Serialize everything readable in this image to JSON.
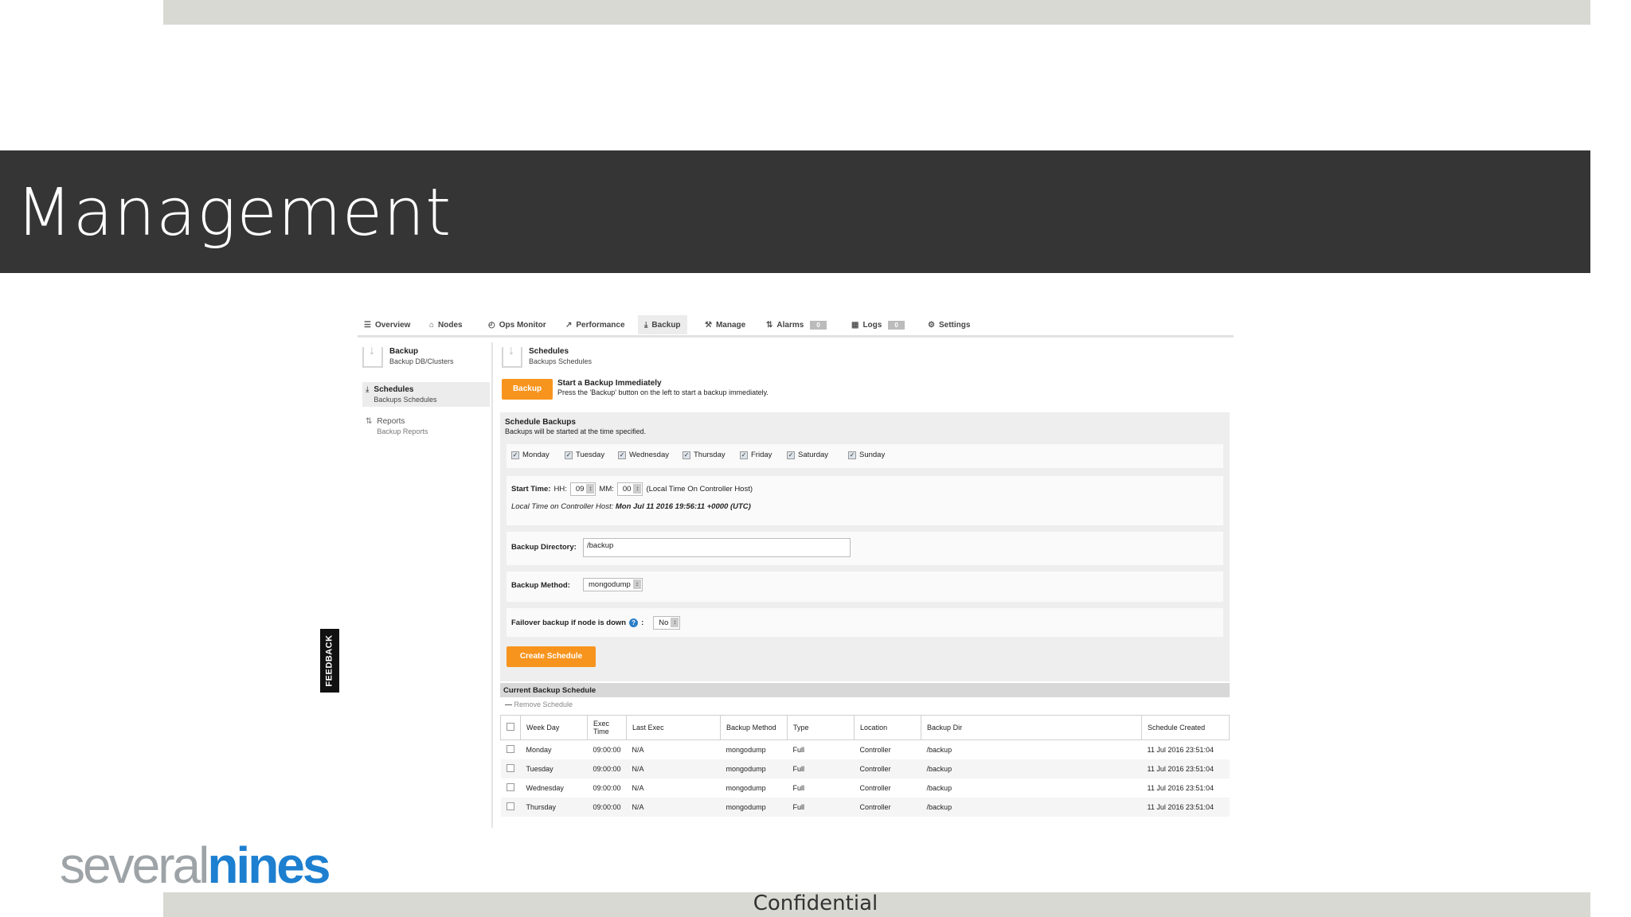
{
  "slide": {
    "title": "Management",
    "footer": "Confidential",
    "logo_part1": "several",
    "logo_part2": "nines",
    "feedback_tab": "FEEDBACK"
  },
  "colors": {
    "title_band": "#353535",
    "accent_orange": "#f7941d",
    "logo_gray": "#9da3a6",
    "logo_blue": "#1d7fd0"
  },
  "tabs": [
    {
      "label": "Overview",
      "icon": "list-icon"
    },
    {
      "label": "Nodes",
      "icon": "nodes-icon"
    },
    {
      "label": "Ops Monitor",
      "icon": "clock-icon"
    },
    {
      "label": "Performance",
      "icon": "chart-icon"
    },
    {
      "label": "Backup",
      "icon": "download-icon",
      "active": true
    },
    {
      "label": "Manage",
      "icon": "wrench-icon"
    },
    {
      "label": "Alarms",
      "icon": "alarm-icon",
      "badge": "0"
    },
    {
      "label": "Logs",
      "icon": "logs-icon",
      "badge": "0"
    },
    {
      "label": "Settings",
      "icon": "gear-icon"
    }
  ],
  "sidebar": {
    "header": {
      "title": "Backup",
      "subtitle": "Backup DB/Clusters"
    },
    "items": [
      {
        "title": "Schedules",
        "subtitle": "Backups Schedules"
      },
      {
        "title": "Reports",
        "subtitle": "Backup Reports"
      }
    ]
  },
  "main": {
    "header_title": "Schedules",
    "header_subtitle": "Backups Schedules",
    "backup_button": "Backup",
    "start_title": "Start a Backup Immediately",
    "start_desc": "Press the 'Backup' button on the left to start a backup immediately.",
    "schedule_title": "Schedule Backups",
    "schedule_sub": "Backups will be started at the time specified.",
    "days": [
      "Monday",
      "Tuesday",
      "Wednesday",
      "Thursday",
      "Friday",
      "Saturday",
      "Sunday"
    ],
    "start_time_label": "Start Time:",
    "hh_label": "HH:",
    "hh_value": "09",
    "mm_label": "MM:",
    "mm_value": "00",
    "local_time_note": "(Local Time On Controller Host)",
    "controller_time_label": "Local Time on Controller Host:",
    "controller_time_value": "Mon Jul 11 2016 19:56:11 +0000 (UTC)",
    "backup_dir_label": "Backup Directory:",
    "backup_dir_value": "/backup",
    "method_label": "Backup Method:",
    "method_value": "mongodump",
    "failover_label": "Failover backup if node is down",
    "failover_colon": ":",
    "failover_value": "No",
    "create_button": "Create Schedule"
  },
  "current": {
    "title": "Current Backup Schedule",
    "remove": "Remove Schedule",
    "columns": [
      "Week Day",
      "Exec Time",
      "Last Exec",
      "Backup Method",
      "Type",
      "Location",
      "Backup Dir",
      "Schedule Created"
    ],
    "rows": [
      [
        "Monday",
        "09:00:00",
        "N/A",
        "mongodump",
        "Full",
        "Controller",
        "/backup",
        "11 Jul 2016 23:51:04"
      ],
      [
        "Tuesday",
        "09:00:00",
        "N/A",
        "mongodump",
        "Full",
        "Controller",
        "/backup",
        "11 Jul 2016 23:51:04"
      ],
      [
        "Wednesday",
        "09:00:00",
        "N/A",
        "mongodump",
        "Full",
        "Controller",
        "/backup",
        "11 Jul 2016 23:51:04"
      ],
      [
        "Thursday",
        "09:00:00",
        "N/A",
        "mongodump",
        "Full",
        "Controller",
        "/backup",
        "11 Jul 2016 23:51:04"
      ]
    ]
  }
}
